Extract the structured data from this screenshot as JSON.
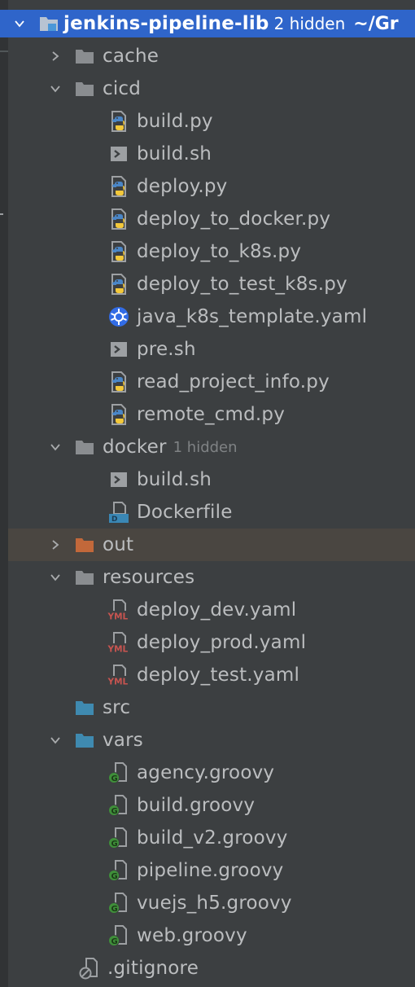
{
  "project": {
    "name": "jenkins-pipeline-lib",
    "hidden": "2 hidden",
    "path": "~/Gr"
  },
  "colors": {
    "background": "#3c3f41",
    "selection": "#2f65ca",
    "folder": "#8a8d90",
    "source_folder": "#3f8ab0",
    "excluded_folder": "#c2683a",
    "groovy_badge": "#3f8f3a"
  },
  "tree": [
    {
      "label": "cache",
      "icon": "folder-icon",
      "arrow": "collapsed"
    },
    {
      "label": "cicd",
      "icon": "folder-icon",
      "arrow": "expanded"
    },
    {
      "label": "build.py",
      "icon": "python-file-icon"
    },
    {
      "label": "build.sh",
      "icon": "shell-file-icon"
    },
    {
      "label": "deploy.py",
      "icon": "python-file-icon"
    },
    {
      "label": "deploy_to_docker.py",
      "icon": "python-file-icon"
    },
    {
      "label": "deploy_to_k8s.py",
      "icon": "python-file-icon"
    },
    {
      "label": "deploy_to_test_k8s.py",
      "icon": "python-file-icon"
    },
    {
      "label": "java_k8s_template.yaml",
      "icon": "kubernetes-icon"
    },
    {
      "label": "pre.sh",
      "icon": "shell-file-icon"
    },
    {
      "label": "read_project_info.py",
      "icon": "python-file-icon"
    },
    {
      "label": "remote_cmd.py",
      "icon": "python-file-icon"
    },
    {
      "label": "docker",
      "icon": "folder-icon",
      "arrow": "expanded",
      "hint": "1 hidden"
    },
    {
      "label": "build.sh",
      "icon": "shell-file-icon"
    },
    {
      "label": "Dockerfile",
      "icon": "dockerfile-icon"
    },
    {
      "label": "out",
      "icon": "excluded-folder-icon",
      "arrow": "collapsed"
    },
    {
      "label": "resources",
      "icon": "folder-icon",
      "arrow": "expanded"
    },
    {
      "label": "deploy_dev.yaml",
      "icon": "yaml-file-icon",
      "badge": "YML"
    },
    {
      "label": "deploy_prod.yaml",
      "icon": "yaml-file-icon",
      "badge": "YML"
    },
    {
      "label": "deploy_test.yaml",
      "icon": "yaml-file-icon",
      "badge": "YML"
    },
    {
      "label": "src",
      "icon": "source-folder-icon"
    },
    {
      "label": "vars",
      "icon": "source-folder-icon",
      "arrow": "expanded"
    },
    {
      "label": "agency.groovy",
      "icon": "groovy-file-icon",
      "badge": "G"
    },
    {
      "label": "build.groovy",
      "icon": "groovy-file-icon",
      "badge": "G"
    },
    {
      "label": "build_v2.groovy",
      "icon": "groovy-file-icon",
      "badge": "G"
    },
    {
      "label": "pipeline.groovy",
      "icon": "groovy-file-icon",
      "badge": "G"
    },
    {
      "label": "vuejs_h5.groovy",
      "icon": "groovy-file-icon",
      "badge": "G"
    },
    {
      "label": "web.groovy",
      "icon": "groovy-file-icon",
      "badge": "G"
    },
    {
      "label": ".gitignore",
      "icon": "ignore-file-icon"
    }
  ]
}
